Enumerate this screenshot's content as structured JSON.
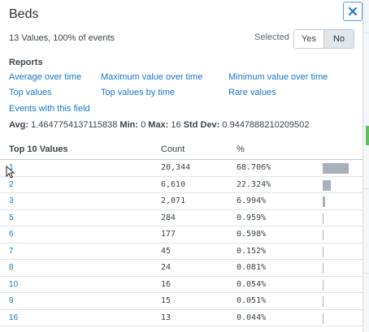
{
  "header": {
    "title": "Beds"
  },
  "summary": "13 Values, 100% of events",
  "selected": {
    "label": "Selected",
    "yes": "Yes",
    "no": "No",
    "active": "No"
  },
  "reports": {
    "heading": "Reports",
    "links": [
      "Average over time",
      "Maximum value over time",
      "Minimum value over time",
      "Top values",
      "Top values by time",
      "Rare values",
      "Events with this field"
    ]
  },
  "stats": {
    "avg_label": "Avg:",
    "avg": "1.4647754137115838",
    "min_label": "Min:",
    "min": "0",
    "max_label": "Max:",
    "max": "16",
    "std_label": "Std Dev:",
    "std": "0.9447888210209502"
  },
  "table": {
    "headers": [
      "Top 10 Values",
      "Count",
      "%"
    ],
    "rows": [
      {
        "value": "1",
        "count": "20,344",
        "pct": "68.706%",
        "fraction": 0.68706
      },
      {
        "value": "2",
        "count": "6,610",
        "pct": "22.324%",
        "fraction": 0.22324
      },
      {
        "value": "3",
        "count": "2,071",
        "pct": "6.994%",
        "fraction": 0.06994
      },
      {
        "value": "5",
        "count": "284",
        "pct": "0.959%",
        "fraction": 0.00959
      },
      {
        "value": "6",
        "count": "177",
        "pct": "0.598%",
        "fraction": 0.00598
      },
      {
        "value": "7",
        "count": "45",
        "pct": "0.152%",
        "fraction": 0.00152
      },
      {
        "value": "8",
        "count": "24",
        "pct": "0.081%",
        "fraction": 0.00081
      },
      {
        "value": "10",
        "count": "16",
        "pct": "0.054%",
        "fraction": 0.00054
      },
      {
        "value": "9",
        "count": "15",
        "pct": "0.051%",
        "fraction": 0.00051
      },
      {
        "value": "16",
        "count": "13",
        "pct": "0.044%",
        "fraction": 0.00044
      }
    ]
  },
  "colors": {
    "link": "#1a76c4",
    "bar": "#a7b0bb",
    "close_border": "#5a9bd5"
  },
  "icons": {
    "close": "close-icon",
    "cursor": "mouse-pointer-icon"
  }
}
